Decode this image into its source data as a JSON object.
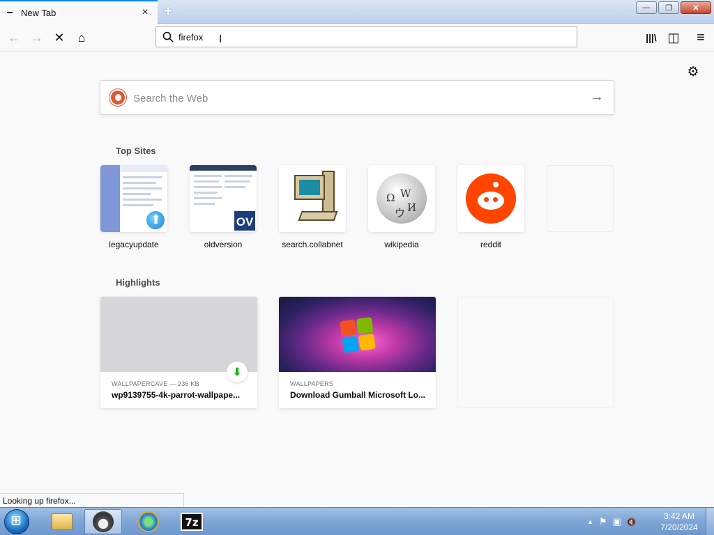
{
  "tab": {
    "title": "New Tab",
    "close_icon": "×"
  },
  "newtab_icon": "+",
  "window_controls": {
    "minimize": "—",
    "maximize": "❐",
    "close": "✕"
  },
  "nav": {
    "back": "←",
    "forward": "→",
    "stop": "✕",
    "home": "⌂"
  },
  "urlbar": {
    "value": "firefox"
  },
  "toolbar_icons": {
    "library": "|||\\",
    "sidebar": "◫",
    "menu": "≡"
  },
  "settings_icon": "⚙",
  "search": {
    "placeholder": "Search the Web",
    "go": "→"
  },
  "top_sites": {
    "title": "Top Sites",
    "items": [
      {
        "label": "legacyupdate"
      },
      {
        "label": "oldversion",
        "badge": "OV"
      },
      {
        "label": "search.collabnet"
      },
      {
        "label": "wikipedia",
        "glyphs": [
          "Ω",
          "W",
          "И",
          "ウ"
        ]
      },
      {
        "label": "reddit"
      },
      {
        "label": ""
      }
    ]
  },
  "highlights": {
    "title": "Highlights",
    "items": [
      {
        "source": "WALLPAPERCAVE — 236 KB",
        "title": "wp9139755-4k-parrot-wallpape...",
        "icon": "⬇"
      },
      {
        "source": "WALLPAPERS",
        "title": "Download Gumball Microsoft Lo...",
        "icon": "◷"
      }
    ]
  },
  "status": {
    "text": "Looking up firefox..."
  },
  "taskbar": {
    "sevenzip_label": "7z",
    "tray": {
      "chevron": "▲",
      "flag": "⚑",
      "network": "▣",
      "volume": "🔇"
    },
    "clock": {
      "time": "3:42 AM",
      "date": "7/20/2024"
    }
  },
  "colors": {
    "accent": "#0a84ff",
    "ddg": "#de5833",
    "reddit": "#ff4500",
    "download": "#12bc00"
  }
}
